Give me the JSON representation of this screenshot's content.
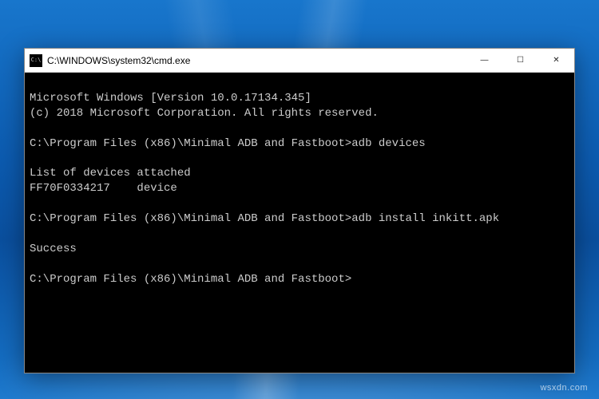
{
  "window": {
    "title": "C:\\WINDOWS\\system32\\cmd.exe",
    "icon_label": "C:\\"
  },
  "controls": {
    "minimize": "—",
    "maximize": "☐",
    "close": "✕"
  },
  "terminal": {
    "line1": "Microsoft Windows [Version 10.0.17134.345]",
    "line2": "(c) 2018 Microsoft Corporation. All rights reserved.",
    "blank1": "",
    "prompt1": "C:\\Program Files (x86)\\Minimal ADB and Fastboot>",
    "cmd1": "adb devices",
    "out1a": "List of devices attached",
    "out1b": "FF70F0334217    device",
    "blank2": "",
    "prompt2": "C:\\Program Files (x86)\\Minimal ADB and Fastboot>",
    "cmd2": "adb install inkitt.apk",
    "out2": "Success",
    "blank3": "",
    "prompt3": "C:\\Program Files (x86)\\Minimal ADB and Fastboot>"
  },
  "watermark": "wsxdn.com"
}
